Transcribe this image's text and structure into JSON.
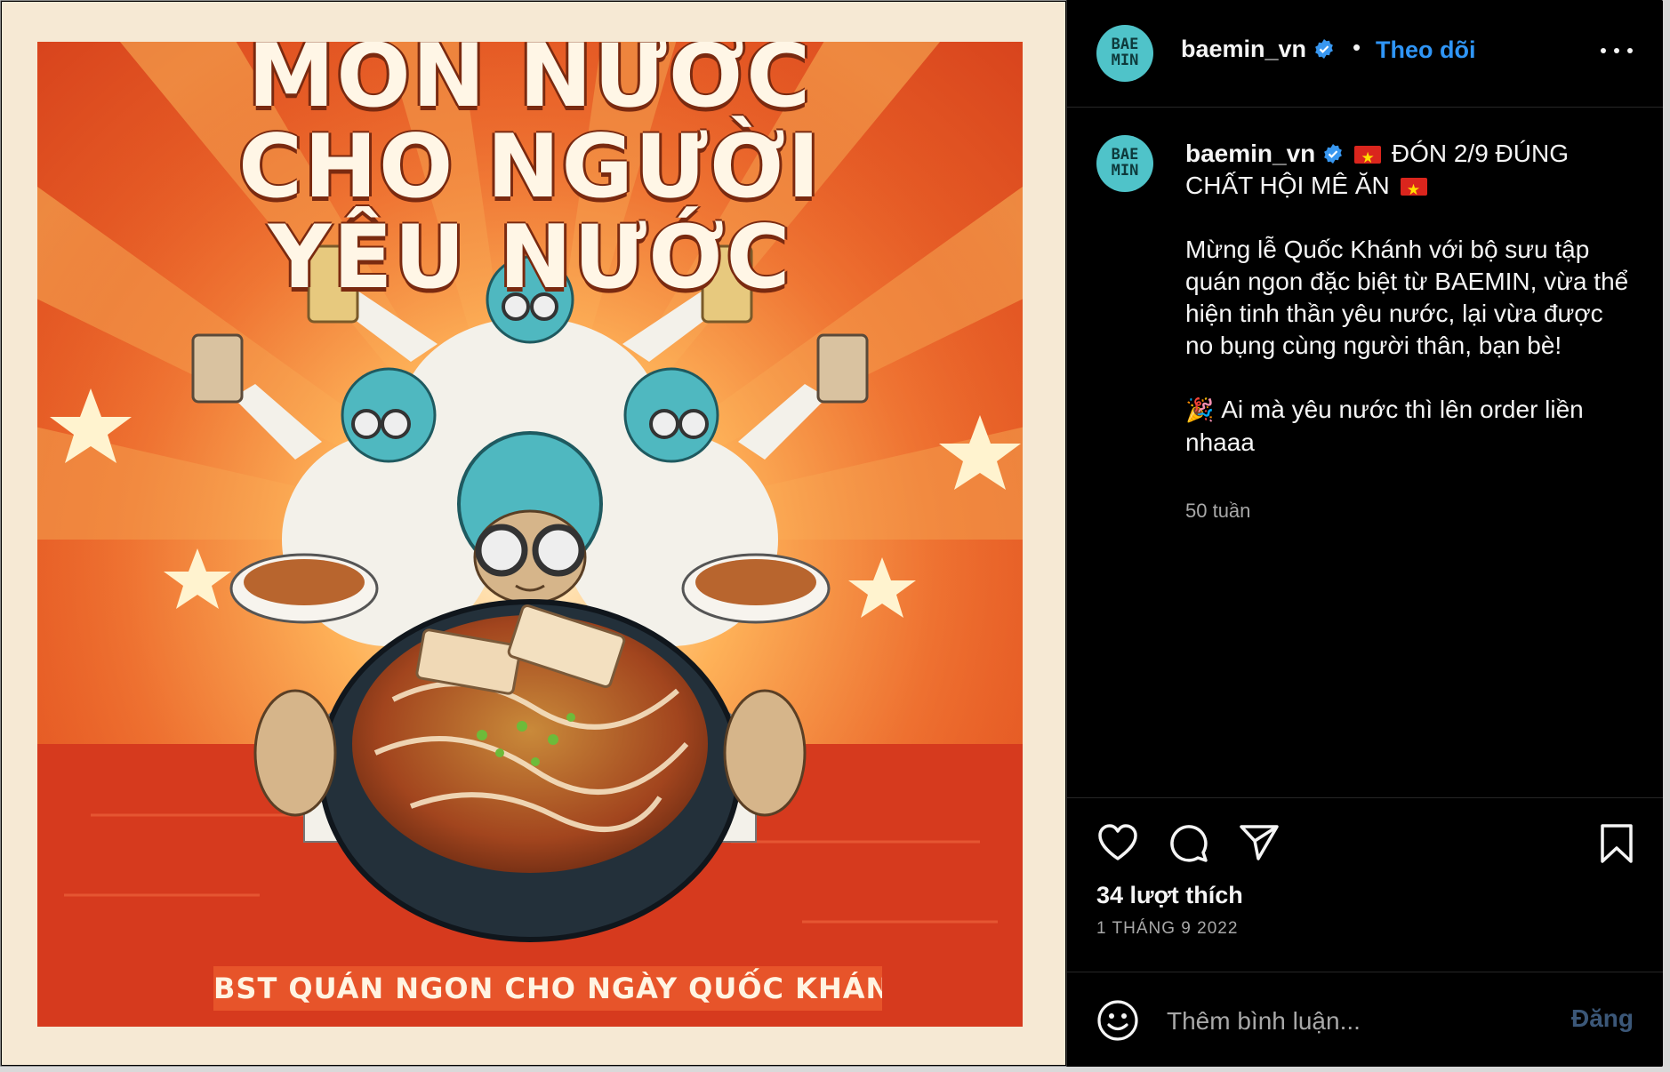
{
  "post_image": {
    "title_lines": [
      "MÓN NƯỚC",
      "CHO NGƯỜI",
      "YÊU NƯỚC"
    ],
    "banner": "BST QUÁN NGON CHO NGÀY QUỐC KHÁNH",
    "colors": {
      "background": "#f6e9d4",
      "orange": "#ee6a2a",
      "red_floor": "#d63a1e",
      "helmet": "#4fb8c0"
    }
  },
  "header": {
    "avatar_lines": [
      "BAE",
      "MIN"
    ],
    "username": "baemin_vn",
    "separator": "•",
    "follow_label": "Theo dõi",
    "more_icon": "more-horizontal-icon"
  },
  "caption": {
    "username": "baemin_vn",
    "line1": "ĐÓN 2/9 ĐÚNG",
    "line2": "CHẤT HỘI MÊ ĂN",
    "paragraph1": "Mừng lễ Quốc Khánh với bộ sưu tập quán ngon đặc biệt từ BAEMIN, vừa thể hiện tinh thần yêu nước, lại vừa được no bụng cùng người thân, bạn bè!",
    "paragraph2": "Ai mà yêu nước thì lên order liền nhaaa",
    "time_ago": "50 tuần"
  },
  "actions": {
    "icons": [
      "heart-icon",
      "comment-icon",
      "share-icon",
      "bookmark-icon"
    ],
    "likes": "34 lượt thích",
    "date": "1 THÁNG 9 2022"
  },
  "comment": {
    "placeholder": "Thêm bình luận...",
    "post_label": "Đăng",
    "emoji_icon": "emoji-icon"
  },
  "colors": {
    "accent_blue": "#2f95f6",
    "verified": "#3897f0",
    "muted": "#a8a8a8",
    "panel_bg": "#000000"
  }
}
